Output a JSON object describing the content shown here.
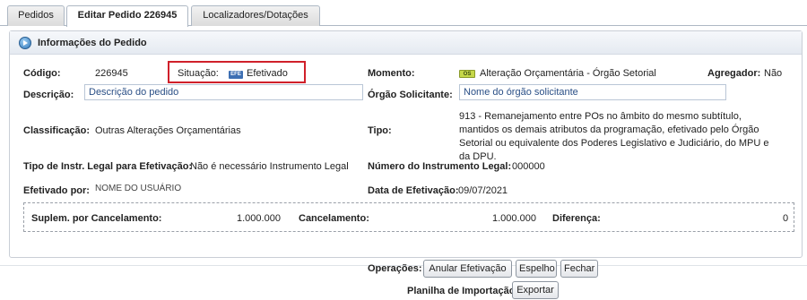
{
  "tabs": [
    {
      "label": "Pedidos",
      "active": false
    },
    {
      "label": "Editar Pedido 226945",
      "active": true
    },
    {
      "label": "Localizadores/Dotações",
      "active": false
    }
  ],
  "panel": {
    "title": "Informações do Pedido",
    "icon": "info-arrow-icon"
  },
  "fields": {
    "codigo": {
      "label": "Código:",
      "value": "226945"
    },
    "situacao": {
      "label": "Situação:",
      "badge": "EFE",
      "value": "Efetivado"
    },
    "momento": {
      "label": "Momento:",
      "badge": "OS",
      "value": "Alteração Orçamentária - Órgão Setorial"
    },
    "agregador": {
      "label": "Agregador:",
      "value": "Não"
    },
    "descricao": {
      "label": "Descrição:",
      "value": "Descrição do pedido"
    },
    "orgao_solicitante": {
      "label": "Órgão Solicitante:",
      "value": "Nome do órgão solicitante"
    },
    "classificacao": {
      "label": "Classificação:",
      "value": "Outras Alterações Orçamentárias"
    },
    "tipo": {
      "label": "Tipo:",
      "value": "913 - Remanejamento entre POs no âmbito do mesmo subtítulo, mantidos os demais atributos da programação, efetivado pelo Órgão Setorial ou equivalente dos Poderes Legislativo e Judiciário, do MPU e da DPU."
    },
    "tipo_instr_legal": {
      "label": "Tipo de Instr. Legal para Efetivação:",
      "value": "Não é necessário Instrumento Legal"
    },
    "numero_instrumento": {
      "label": "Número do Instrumento Legal:",
      "value": "000000"
    },
    "efetivado_por": {
      "label": "Efetivado por:",
      "value": "NOME DO USUÁRIO"
    },
    "data_efetivacao": {
      "label": "Data de Efetivação:",
      "value": "09/07/2021"
    }
  },
  "totals": {
    "suplem_cancelamento": {
      "label": "Suplem. por Cancelamento:",
      "value": "1.000.000"
    },
    "cancelamento": {
      "label": "Cancelamento:",
      "value": "1.000.000"
    },
    "diferenca": {
      "label": "Diferença:",
      "value": "0"
    }
  },
  "operations": {
    "label": "Operações:",
    "buttons": [
      "Anular Efetivação",
      "Espelho",
      "Fechar"
    ]
  },
  "import_sheet": {
    "label": "Planilha de Importação:",
    "button": "Exportar"
  },
  "colors": {
    "highlight_border": "#d0202a",
    "badge_blue": "#3d6fb3",
    "badge_green": "#c6d84a",
    "field_text": "#2a4f86"
  }
}
